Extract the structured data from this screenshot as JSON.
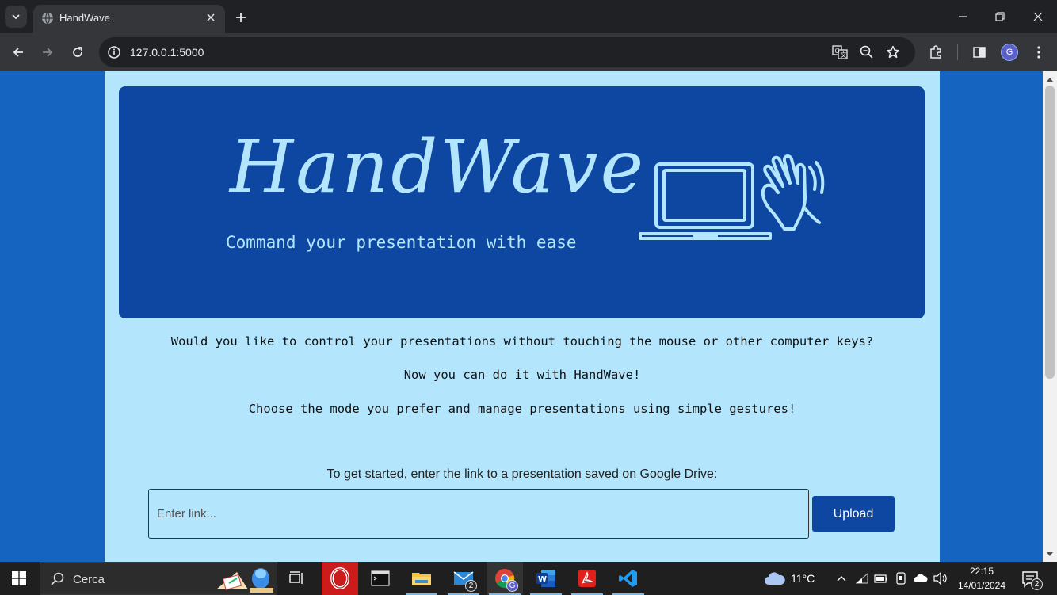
{
  "browser": {
    "tab_title": "HandWave",
    "url": "127.0.0.1:5000",
    "profile_initial": "G"
  },
  "hero": {
    "title": "HandWave",
    "subtitle": "Command your presentation with ease"
  },
  "intro": {
    "line1": "Would you like to control your presentations without touching the mouse or other computer keys?",
    "line2": "Now you can do it with HandWave!",
    "line3": "Choose the mode you prefer and manage presentations using simple gestures!"
  },
  "upload": {
    "prompt": "To get started, enter the link to a presentation saved on Google Drive:",
    "placeholder": "Enter link...",
    "value": "",
    "button_label": "Upload"
  },
  "taskbar": {
    "search_text": "Cerca",
    "mail_badge": "2",
    "chrome_badge": "G",
    "weather": "11°C",
    "time": "22:15",
    "date": "14/01/2024",
    "notification_count": "2"
  },
  "colors": {
    "page_background": "#1565c0",
    "card_background": "#b3e5fc",
    "hero_background": "#0d47a1",
    "accent_button": "#0d47a1"
  }
}
